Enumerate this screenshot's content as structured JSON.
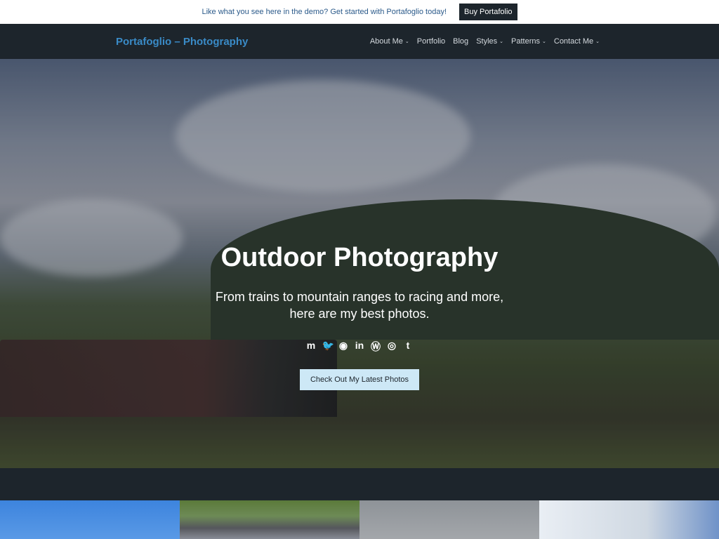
{
  "banner": {
    "text": "Like what you see here in the demo? Get started with Portafoglio today!",
    "button": "Buy Portafolio"
  },
  "header": {
    "site_title": "Portafoglio – Photography",
    "nav": [
      {
        "label": "About Me",
        "has_submenu": true
      },
      {
        "label": "Portfolio",
        "has_submenu": false
      },
      {
        "label": "Blog",
        "has_submenu": false
      },
      {
        "label": "Styles",
        "has_submenu": true
      },
      {
        "label": "Patterns",
        "has_submenu": true
      },
      {
        "label": "Contact Me",
        "has_submenu": true
      }
    ]
  },
  "hero": {
    "title": "Outdoor Photography",
    "subtitle": "From trains to mountain ranges to racing and more, here are my best photos.",
    "socials": [
      {
        "name": "mastodon",
        "glyph": "m"
      },
      {
        "name": "twitter",
        "glyph": "🐦"
      },
      {
        "name": "github",
        "glyph": "◉"
      },
      {
        "name": "linkedin",
        "glyph": "in"
      },
      {
        "name": "wordpress",
        "glyph": "Ⓦ"
      },
      {
        "name": "instagram",
        "glyph": "◎"
      },
      {
        "name": "tumblr",
        "glyph": "t"
      }
    ],
    "cta": "Check Out My Latest Photos"
  },
  "chev": "⌄"
}
